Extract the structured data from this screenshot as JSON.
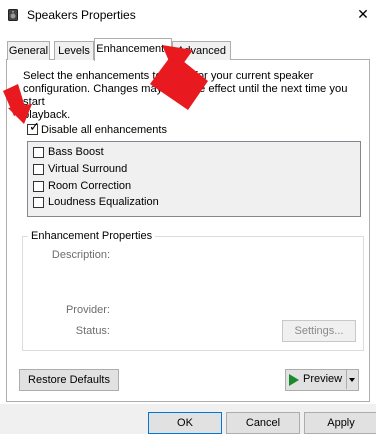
{
  "window": {
    "title": "Speakers Properties",
    "close_glyph": "✕"
  },
  "tabs": [
    {
      "label": "General",
      "selected": false
    },
    {
      "label": "Levels",
      "selected": false
    },
    {
      "label": "Enhancements",
      "selected": true
    },
    {
      "label": "Advanced",
      "selected": false
    }
  ],
  "enhancements": {
    "intro_line1": "Select the enhancements to apply for your current speaker",
    "intro_line2": "configuration. Changes may not take effect until the next time you start",
    "intro_line3": "playback.",
    "disable_all": {
      "label": "Disable all enhancements",
      "checked": true
    },
    "items": [
      {
        "label": "Bass Boost",
        "checked": false
      },
      {
        "label": "Virtual Surround",
        "checked": false
      },
      {
        "label": "Room Correction",
        "checked": false
      },
      {
        "label": "Loudness Equalization",
        "checked": false
      }
    ]
  },
  "properties": {
    "group_title": "Enhancement Properties",
    "description_label": "Description:",
    "provider_label": "Provider:",
    "status_label": "Status:",
    "settings_button": "Settings..."
  },
  "buttons": {
    "restore_defaults": "Restore Defaults",
    "preview": "Preview",
    "ok": "OK",
    "cancel": "Cancel",
    "apply": "Apply"
  },
  "colors": {
    "annotation_arrow": "#e8191f",
    "preview_play": "#1b8a2c",
    "ok_border": "#0078d7"
  }
}
